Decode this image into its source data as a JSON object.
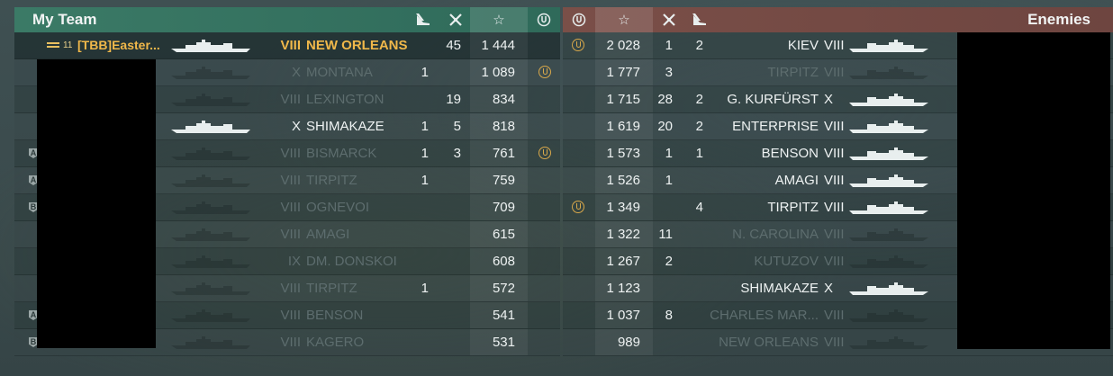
{
  "my_team": {
    "title": "My Team",
    "header_icons": [
      "plane-kill-icon",
      "frag-icon",
      "star-icon",
      "emblem-icon"
    ],
    "rows": [
      {
        "player": "[TBB]Easter...",
        "rank": "11",
        "tier": "VIII",
        "ship": "NEW ORLEANS",
        "planes": "",
        "frags": "45",
        "xp": "1 444",
        "emblem": false,
        "style": "gold",
        "badge": ""
      },
      {
        "player": "",
        "tier": "X",
        "ship": "MONTANA",
        "planes": "1",
        "frags": "",
        "xp": "1 089",
        "emblem": true,
        "style": "dim",
        "badge": ""
      },
      {
        "player": "",
        "tier": "VIII",
        "ship": "LEXINGTON",
        "planes": "",
        "frags": "19",
        "xp": "834",
        "emblem": false,
        "style": "dim",
        "badge": ""
      },
      {
        "player": "",
        "tier": "X",
        "ship": "SHIMAKAZE",
        "planes": "1",
        "frags": "5",
        "xp": "818",
        "emblem": false,
        "style": "bright",
        "badge": ""
      },
      {
        "player": "",
        "tier": "VIII",
        "ship": "BISMARCK",
        "planes": "1",
        "frags": "3",
        "xp": "761",
        "emblem": true,
        "style": "dim",
        "badge": "A"
      },
      {
        "player": "",
        "tier": "VIII",
        "ship": "TIRPITZ",
        "planes": "1",
        "frags": "",
        "xp": "759",
        "emblem": false,
        "style": "dim",
        "badge": "A"
      },
      {
        "player": "",
        "tier": "VIII",
        "ship": "OGNEVOI",
        "planes": "",
        "frags": "",
        "xp": "709",
        "emblem": false,
        "style": "dim",
        "badge": "B"
      },
      {
        "player": "",
        "tier": "VIII",
        "ship": "AMAGI",
        "planes": "",
        "frags": "",
        "xp": "615",
        "emblem": false,
        "style": "dim",
        "badge": ""
      },
      {
        "player": "",
        "tier": "IX",
        "ship": "DM. DONSKOI",
        "planes": "",
        "frags": "",
        "xp": "608",
        "emblem": false,
        "style": "dim",
        "badge": ""
      },
      {
        "player": "",
        "tier": "VIII",
        "ship": "TIRPITZ",
        "planes": "1",
        "frags": "",
        "xp": "572",
        "emblem": false,
        "style": "dim",
        "badge": ""
      },
      {
        "player": "",
        "tier": "VIII",
        "ship": "BENSON",
        "planes": "",
        "frags": "",
        "xp": "541",
        "emblem": false,
        "style": "dim",
        "badge": "A"
      },
      {
        "player": "",
        "tier": "VIII",
        "ship": "KAGERO",
        "planes": "",
        "frags": "",
        "xp": "531",
        "emblem": false,
        "style": "dim",
        "badge": "B"
      }
    ]
  },
  "enemies": {
    "title": "Enemies",
    "header_icons": [
      "emblem-icon",
      "star-icon",
      "frag-icon",
      "plane-kill-icon"
    ],
    "rows": [
      {
        "emblem": true,
        "xp": "2 028",
        "frags": "1",
        "planes": "2",
        "ship": "KIEV",
        "tier": "VIII",
        "style": "bright"
      },
      {
        "emblem": false,
        "xp": "1 777",
        "frags": "3",
        "planes": "",
        "ship": "TIRPITZ",
        "tier": "VIII",
        "style": "dim"
      },
      {
        "emblem": false,
        "xp": "1 715",
        "frags": "28",
        "planes": "2",
        "ship": "G. KURFÜRST",
        "tier": "X",
        "style": "bright"
      },
      {
        "emblem": false,
        "xp": "1 619",
        "frags": "20",
        "planes": "2",
        "ship": "ENTERPRISE",
        "tier": "VIII",
        "style": "bright"
      },
      {
        "emblem": false,
        "xp": "1 573",
        "frags": "1",
        "planes": "1",
        "ship": "BENSON",
        "tier": "VIII",
        "style": "bright"
      },
      {
        "emblem": false,
        "xp": "1 526",
        "frags": "1",
        "planes": "",
        "ship": "AMAGI",
        "tier": "VIII",
        "style": "bright"
      },
      {
        "emblem": true,
        "xp": "1 349",
        "frags": "",
        "planes": "4",
        "ship": "TIRPITZ",
        "tier": "VIII",
        "style": "bright"
      },
      {
        "emblem": false,
        "xp": "1 322",
        "frags": "11",
        "planes": "",
        "ship": "N. CAROLINA",
        "tier": "VIII",
        "style": "dim"
      },
      {
        "emblem": false,
        "xp": "1 267",
        "frags": "2",
        "planes": "",
        "ship": "KUTUZOV",
        "tier": "VIII",
        "style": "dim"
      },
      {
        "emblem": false,
        "xp": "1 123",
        "frags": "",
        "planes": "",
        "ship": "SHIMAKAZE",
        "tier": "X",
        "style": "bright"
      },
      {
        "emblem": false,
        "xp": "1 037",
        "frags": "8",
        "planes": "",
        "ship": "CHARLES MAR...",
        "tier": "VIII",
        "style": "dim"
      },
      {
        "emblem": false,
        "xp": "989",
        "frags": "",
        "planes": "",
        "ship": "NEW ORLEANS",
        "tier": "VIII",
        "style": "dim"
      }
    ]
  },
  "colors": {
    "my_team_header": "#3b7a66",
    "enemies_header": "#7a4f48",
    "highlight": "#f0b84a",
    "dim_text": "#5d6d6e"
  }
}
